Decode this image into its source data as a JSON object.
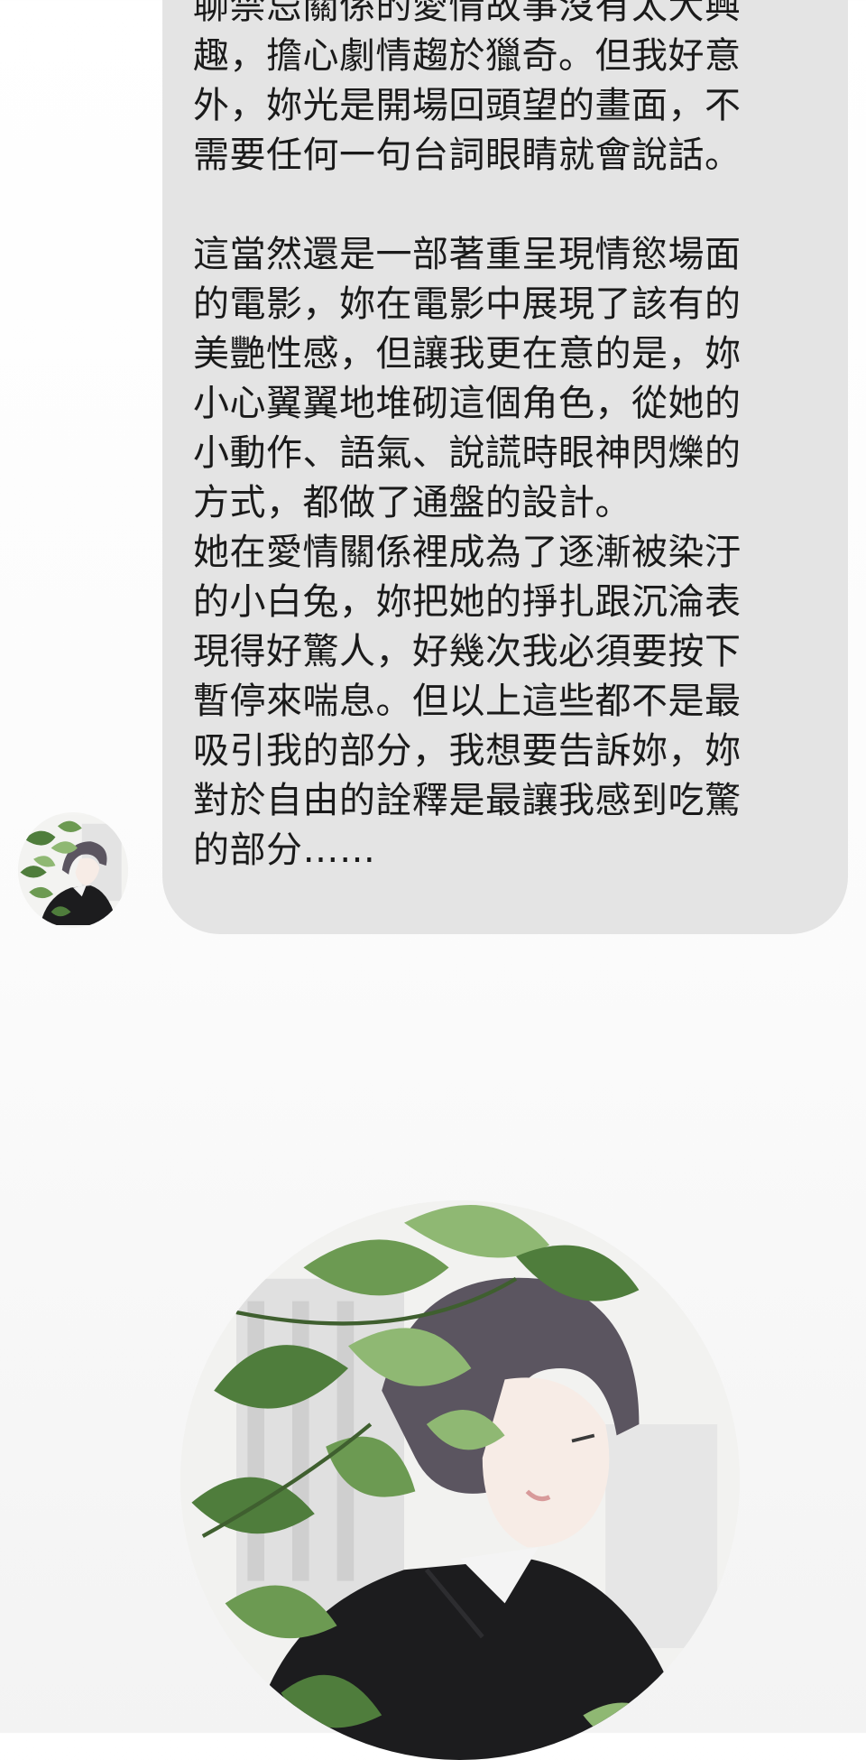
{
  "message": {
    "text": "聊禁忌關係的愛情故事沒有太大興\n趣，擔心劇情趨於獵奇。但我好意\n外，妳光是開場回頭望的畫面，不\n需要任何一句台詞眼睛就會說話。\n\n這當然還是一部著重呈現情慾場面\n的電影，妳在電影中展現了該有的\n美艷性感，但讓我更在意的是，妳\n小心翼翼地堆砌這個角色，從她的\n小動作、語氣、說謊時眼神閃爍的\n方式，都做了通盤的設計。\n她在愛情關係裡成為了逐漸被染汙\n的小白兔，妳把她的掙扎跟沉淪表\n現得好驚人，好幾次我必須要按下\n暫停來喘息。但以上這些都不是最\n吸引我的部分，我想要告訴妳，妳\n對於自由的詮釋是最讓我感到吃驚\n的部分……"
  },
  "colors": {
    "bubble": "#e4e4e4",
    "text": "#1a1a1a",
    "leaf_dark": "#4f7d3c",
    "leaf_light": "#8fb873",
    "hair": "#5b5560",
    "suit": "#1c1c1e",
    "skin": "#f7ece6"
  },
  "icons": {
    "small_avatar": "profile-avatar-icon",
    "large_avatar": "character-portrait-icon"
  }
}
